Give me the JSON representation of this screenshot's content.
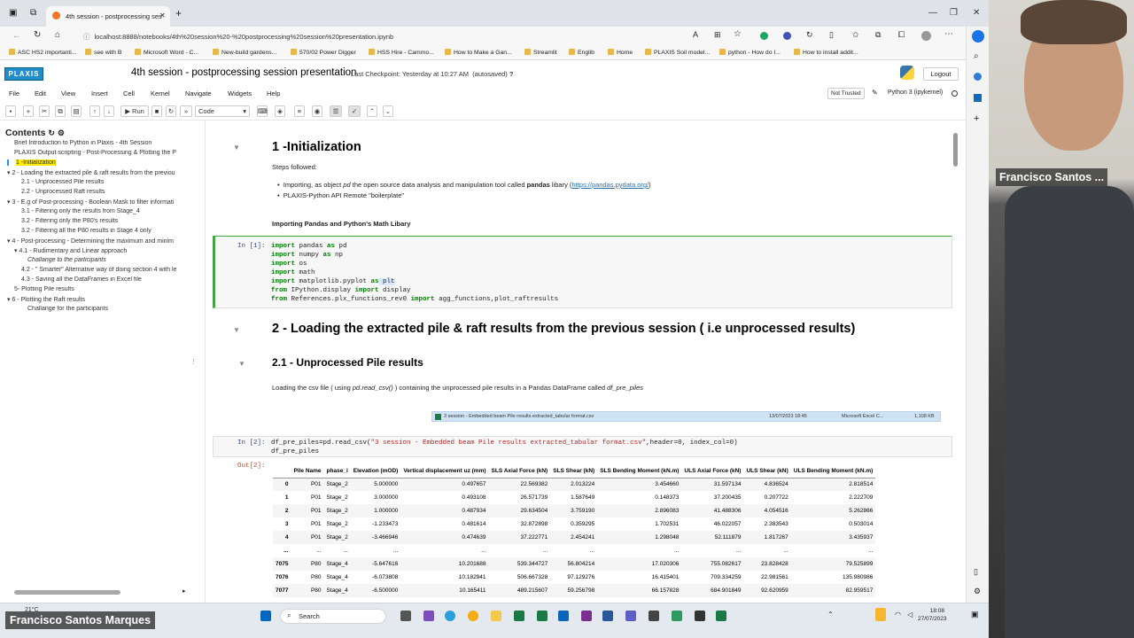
{
  "browser": {
    "tab_title": "4th session - postprocessing ses",
    "address": "localhost:8888/notebooks/4th%20session%20-%20postprocessing%20session%20presentation.ipynb",
    "bookmarks": [
      "ASC HS2 importanti...",
      "see with B",
      "Microsoft Word - C...",
      "New-build gardens...",
      "570/02 Power Digger",
      "HSS Hire - Cammo...",
      "How to Make a Gan...",
      "Streamlit",
      "Englib",
      "Home",
      "PLAXIS Soil model...",
      "python - How do I...",
      "How to install addit..."
    ]
  },
  "jupyter": {
    "logo": "PLAXIS",
    "title": "4th session - postprocessing session presentation",
    "checkpoint": "Last Checkpoint: Yesterday at 10:27 AM",
    "autosaved": "(autosaved)",
    "logout": "Logout",
    "menu": [
      "File",
      "Edit",
      "View",
      "Insert",
      "Cell",
      "Kernel",
      "Navigate",
      "Widgets",
      "Help"
    ],
    "not_trusted": "Not Trusted",
    "kernel": "Python 3 (ipykernel)",
    "toolbar": {
      "run": "Run",
      "cell_type": "Code"
    }
  },
  "toc": {
    "title": "Contents",
    "items": [
      "Brief Introduction to Python in Plaxis - 4th Session",
      "PLAXIS Output scripting - Post-Processing & Plotting the P",
      "1 -Initialization",
      "2 - Loading the extracted pile & raft results from the previou",
      "2.1 - Unprocessed Pile results",
      "2.2 - Unprocessed Raft results",
      "3 - E.g of Post-processing - Boolean Mask to filter informati",
      "3.1 - Filtering only the results from Stage_4",
      "3.2 - Filtering only the P80's results",
      "3.2 - Filtering all the P80 results in Stage 4 only",
      "4 - Post-processing - Determining the maximum and minim",
      "4.1 - Rudimentary and Linear approach",
      "Challange to the participants",
      "4.2 - \" Smarter\" Alternative way of doing section 4 with le",
      "4.3 - Saving all the DataFrames in Excel file",
      "5- Plotting Pile results",
      "6 - Plotting the Raft results",
      "Challange for the participants"
    ]
  },
  "notebook": {
    "h_init": "1 -Initialization",
    "steps": "Steps followed:",
    "bullet1_pre": "Importing, as object ",
    "bullet1_pd": "pd",
    "bullet1_mid": " the open source data analysis and manipulation tool called ",
    "bullet1_pandas": "pandas",
    "bullet1_lib": " libary (",
    "bullet1_link": "https://pandas.pydata.org/",
    "bullet1_end": ")",
    "bullet2": "PLAXIS-Python API Remote \"boilerplate\"",
    "importing_heading": "Importing Pandas and Python's Math Libary",
    "cell1_prompt": "In [1]:",
    "cell1_code": [
      {
        "kw": "import",
        "rest": " pandas ",
        "kw2": "as",
        "tail": " pd"
      },
      {
        "kw": "import",
        "rest": " numpy ",
        "kw2": "as",
        "tail": " np"
      },
      {
        "kw": "import",
        "rest": " os",
        "kw2": "",
        "tail": ""
      },
      {
        "kw": "import",
        "rest": " math",
        "kw2": "",
        "tail": ""
      },
      {
        "kw": "import",
        "rest": " matplotlib.pyplot ",
        "kw2": "as",
        "tail": " plt"
      },
      {
        "kw": "from",
        "rest": " IPython.display ",
        "kw2": "import",
        "tail": " display"
      },
      {
        "kw": "from",
        "rest": " References.plx_functions_rev0 ",
        "kw2": "import",
        "tail": " agg_functions,plot_raftresults"
      }
    ],
    "h_loading": "2 - Loading the extracted pile & raft results from the previous session ( i.e unprocessed results)",
    "h_unprocessed": "2.1 - Unprocessed Pile results",
    "loading_pre": "Loading the csv file ( using ",
    "loading_fn": "pd.read_csv()",
    "loading_mid": " ) containing the unprocessed pile results in a Pandas DataFrame called ",
    "loading_df": "df_pre_piles",
    "file_name": "3 session - Embedded beam Pile results extracted_tabular format.csv",
    "file_date": "13/07/2023 18:45",
    "file_type": "Microsoft Excel C...",
    "file_size": "1,108 KB",
    "cell2_prompt": "In [2]:",
    "cell2_line1_a": "df_pre_piles=pd.read_csv(",
    "cell2_line1_str": "\"3 session - Embedded beam Pile results extracted_tabular format.csv\"",
    "cell2_line1_b": ",header=0, index_col=0)",
    "cell2_line2": "df_pre_piles",
    "out_prompt": "Out[2]:"
  },
  "table": {
    "columns": [
      "",
      "Pile Name",
      "phase_i",
      "Elevation (mOD)",
      "Vertical displacement uz (mm)",
      "SLS Axial Force (kN)",
      "SLS Shear (kN)",
      "SLS Bending Moment (kN.m)",
      "ULS Axial Force (kN)",
      "ULS Shear (kN)",
      "ULS Bending Moment (kN.m)"
    ],
    "rows": [
      [
        "0",
        "P01",
        "Stage_2",
        "5.000000",
        "0.497657",
        "22.569382",
        "2.013224",
        "3.454660",
        "31.597134",
        "4.836524",
        "2.818514"
      ],
      [
        "1",
        "P01",
        "Stage_2",
        "3.000000",
        "0.493108",
        "26.571739",
        "1.587649",
        "0.148373",
        "37.200435",
        "0.207722",
        "2.222709"
      ],
      [
        "2",
        "P01",
        "Stage_2",
        "1.000000",
        "0.487934",
        "29.634504",
        "3.759190",
        "2.896083",
        "41.488306",
        "4.054516",
        "5.262866"
      ],
      [
        "3",
        "P01",
        "Stage_2",
        "-1.233473",
        "0.481614",
        "32.872898",
        "0.359295",
        "1.702531",
        "46.022057",
        "2.383543",
        "0.503014"
      ],
      [
        "4",
        "P01",
        "Stage_2",
        "-3.466946",
        "0.474639",
        "37.222771",
        "2.454241",
        "1.298048",
        "52.111879",
        "1.817267",
        "3.435937"
      ],
      [
        "...",
        "...",
        "...",
        "...",
        "...",
        "...",
        "...",
        "...",
        "...",
        "...",
        "..."
      ],
      [
        "7075",
        "P80",
        "Stage_4",
        "-5.647616",
        "10.201688",
        "539.344727",
        "56.804214",
        "17.020306",
        "755.082617",
        "23.828428",
        "79.525899"
      ],
      [
        "7076",
        "P80",
        "Stage_4",
        "-6.073808",
        "10.182941",
        "506.667328",
        "97.129276",
        "16.415401",
        "709.334259",
        "22.981561",
        "135.980986"
      ],
      [
        "7077",
        "P80",
        "Stage_4",
        "-6.500000",
        "10.165411",
        "489.215607",
        "59.256798",
        "66.157828",
        "684.901849",
        "92.620959",
        "82.959517"
      ]
    ]
  },
  "taskbar": {
    "search": "Search",
    "temp": "21°C",
    "time": "18:08",
    "date": "27/07/2023"
  },
  "webcam": {
    "name_short": "Francisco Santos ...",
    "name_full": "Francisco Santos Marques"
  }
}
